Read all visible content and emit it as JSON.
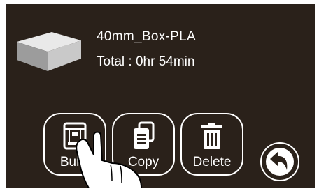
{
  "file": {
    "name": "40mm_Box-PLA",
    "total_time": "Total : 0hr 54min"
  },
  "actions": {
    "build_label": "Build",
    "copy_label": "Copy",
    "delete_label": "Delete"
  },
  "icons": {
    "thumbnail": "box-model-thumbnail",
    "build": "printer-icon",
    "copy": "copy-icon",
    "delete": "trash-icon",
    "back": "back-arrow-icon",
    "hand": "pointing-hand-icon"
  },
  "colors": {
    "background": "#2a211a",
    "foreground": "#ffffff"
  }
}
